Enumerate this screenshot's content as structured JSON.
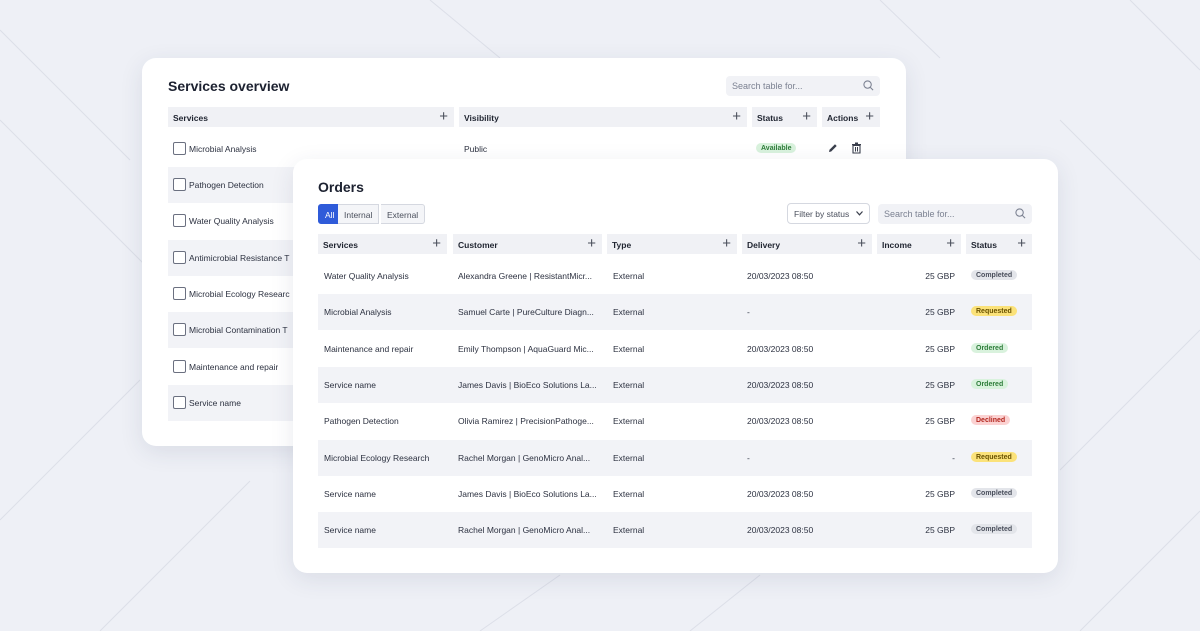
{
  "services_panel": {
    "title": "Services overview",
    "search_placeholder": "Search table for...",
    "columns": [
      "Services",
      "Visibility",
      "Status",
      "Actions"
    ],
    "rows": [
      {
        "name": "Microbial Analysis",
        "visibility": "Public",
        "status": "Available"
      },
      {
        "name": "Pathogen Detection"
      },
      {
        "name": "Water Quality Analysis"
      },
      {
        "name": "Antimicrobial Resistance T"
      },
      {
        "name": "Microbial Ecology Researc"
      },
      {
        "name": "Microbial Contamination T"
      },
      {
        "name": "Maintenance and repair"
      },
      {
        "name": "Service name"
      }
    ]
  },
  "orders_panel": {
    "title": "Orders",
    "tabs": [
      "All",
      "Internal",
      "External"
    ],
    "active_tab": "All",
    "filter_label": "Filter by status",
    "search_placeholder": "Search table for...",
    "columns": [
      "Services",
      "Customer",
      "Type",
      "Delivery",
      "Income",
      "Status"
    ],
    "rows": [
      {
        "service": "Water Quality Analysis",
        "customer": "Alexandra Greene | ResistantMicr...",
        "type": "External",
        "delivery": "20/03/2023 08:50",
        "income": "25 GBP",
        "status": "Completed"
      },
      {
        "service": "Microbial Analysis",
        "customer": "Samuel Carte | PureCulture Diagn...",
        "type": "External",
        "delivery": "-",
        "income": "25 GBP",
        "status": "Requested"
      },
      {
        "service": "Maintenance and repair",
        "customer": "Emily Thompson | AquaGuard Mic...",
        "type": "External",
        "delivery": "20/03/2023 08:50",
        "income": "25 GBP",
        "status": "Ordered"
      },
      {
        "service": "Service name",
        "customer": "James Davis | BioEco Solutions La...",
        "type": "External",
        "delivery": "20/03/2023 08:50",
        "income": "25 GBP",
        "status": "Ordered"
      },
      {
        "service": "Pathogen Detection",
        "customer": "Olivia Ramirez | PrecisionPathoge...",
        "type": "External",
        "delivery": "20/03/2023 08:50",
        "income": "25 GBP",
        "status": "Declined"
      },
      {
        "service": "Microbial Ecology Research",
        "customer": "Rachel Morgan | GenoMicro Anal...",
        "type": "External",
        "delivery": "-",
        "income": "-",
        "status": "Requested"
      },
      {
        "service": "Service name",
        "customer": "James Davis | BioEco Solutions La...",
        "type": "External",
        "delivery": "20/03/2023 08:50",
        "income": "25 GBP",
        "status": "Completed"
      },
      {
        "service": "Service name",
        "customer": "Rachel Morgan | GenoMicro Anal...",
        "type": "External",
        "delivery": "20/03/2023 08:50",
        "income": "25 GBP",
        "status": "Completed"
      }
    ]
  },
  "status_colors": {
    "Available": {
      "bg": "#d9f2dd",
      "fg": "#2e7d3a"
    },
    "Completed": {
      "bg": "#e3e5ea",
      "fg": "#4a4f5c"
    },
    "Requested": {
      "bg": "#fbe27a",
      "fg": "#6a5200"
    },
    "Ordered": {
      "bg": "#d9f2dd",
      "fg": "#2e7d3a"
    },
    "Declined": {
      "bg": "#fbd2d2",
      "fg": "#b3261e"
    }
  },
  "accent_color": "#2f5bd9",
  "icons": {
    "search": "search-icon",
    "add": "plus-icon",
    "edit": "pencil-icon",
    "delete": "trash-icon",
    "dropdown": "chevron-down-icon"
  }
}
